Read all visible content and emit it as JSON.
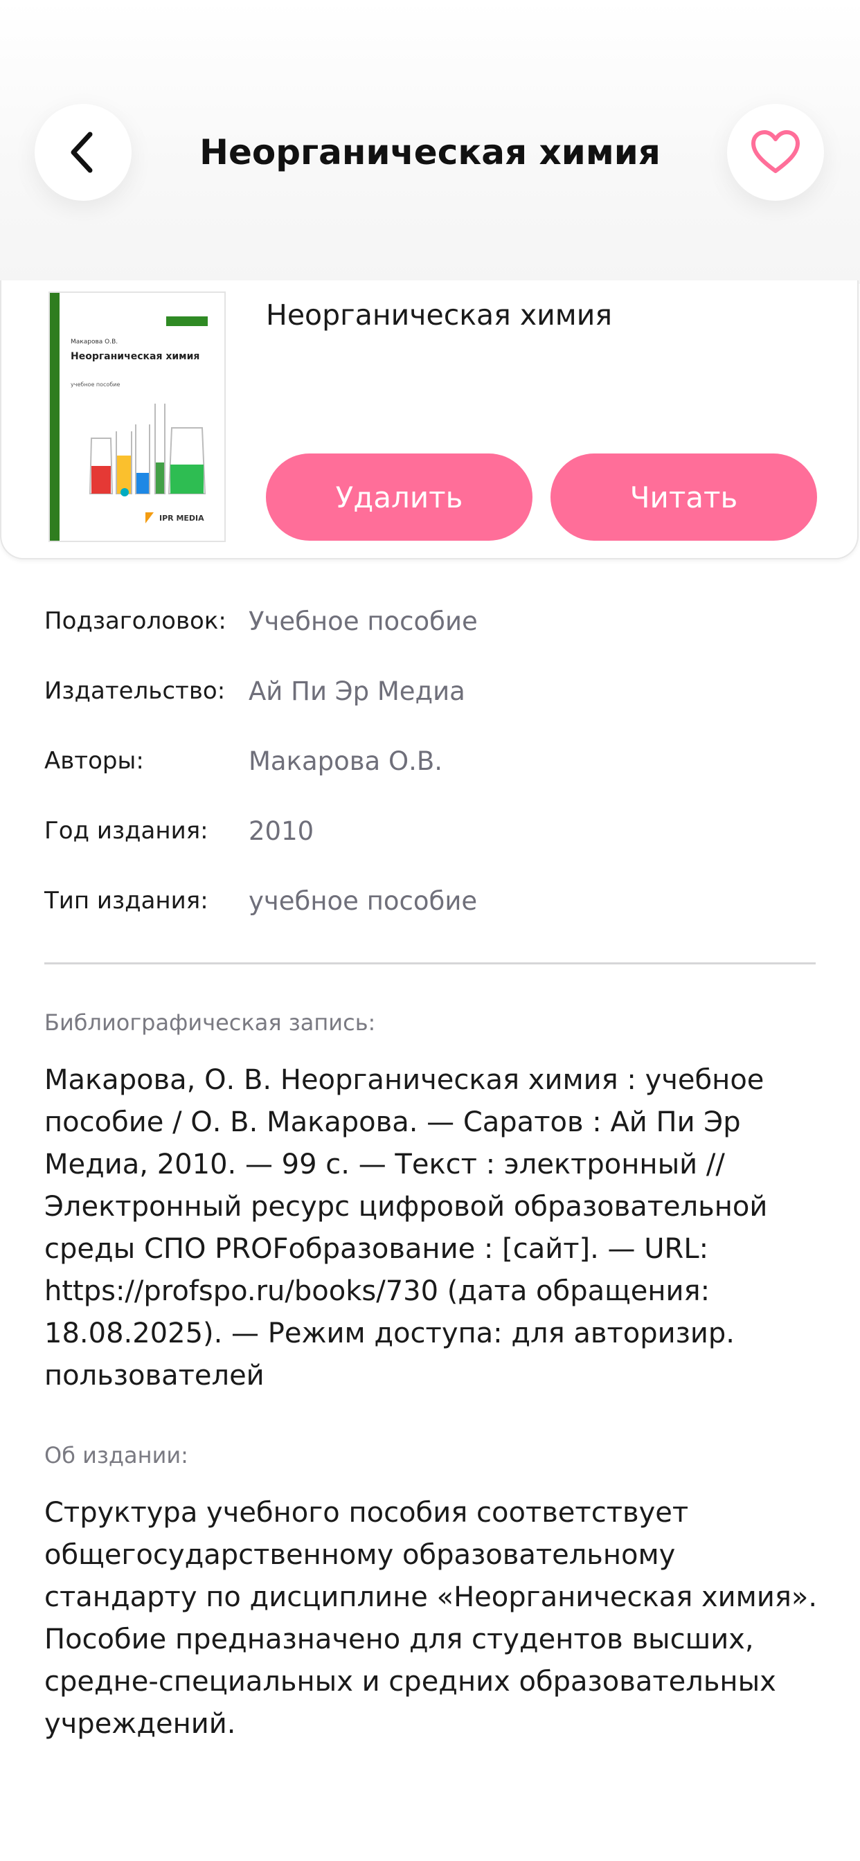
{
  "header": {
    "title": "Неорганическая химия",
    "back_icon": "chevron-left-icon",
    "favorite_icon": "heart-outline-icon"
  },
  "book": {
    "title": "Неорганическая химия",
    "cover": {
      "author": "Макарова О.В.",
      "title": "Неорганическая химия",
      "subtitle": "учебное пособие",
      "publisher_logo": "IPR MEDIA"
    },
    "delete_label": "Удалить",
    "read_label": "Читать"
  },
  "details": [
    {
      "label": "Подзаголовок:",
      "value": "Учебное пособие"
    },
    {
      "label": "Издательство:",
      "value": "Ай Пи Эр Медиа"
    },
    {
      "label": "Авторы:",
      "value": "Макарова О.В."
    },
    {
      "label": "Год издания:",
      "value": "2010"
    },
    {
      "label": "Тип издания:",
      "value": "учебное пособие"
    }
  ],
  "bibliography": {
    "label": "Библиографическая запись:",
    "text": "Макарова, О. В. Неорганическая химия  : учебное пособие / О. В. Макарова. —  Саратов : Ай Пи Эр Медиа, 2010. — 99 с. — Текст : электронный // Электронный ресурс цифровой образовательной среды СПО PROFобразование : [сайт]. — URL: https://profspo.ru/books/730 (дата обращения: 18.08.2025). — Режим доступа: для авторизир. пользователей"
  },
  "about": {
    "label": "Об издании:",
    "text": "Структура учебного пособия соответствует общегосударственному образовательному стандарту по дисциплине «Неорганическая химия». Пособие предназначено для студентов высших, средне-специальных и средних образовательных учреждений."
  },
  "colors": {
    "accent": "#ff6e99",
    "secondary_text": "#6f6f7a"
  }
}
